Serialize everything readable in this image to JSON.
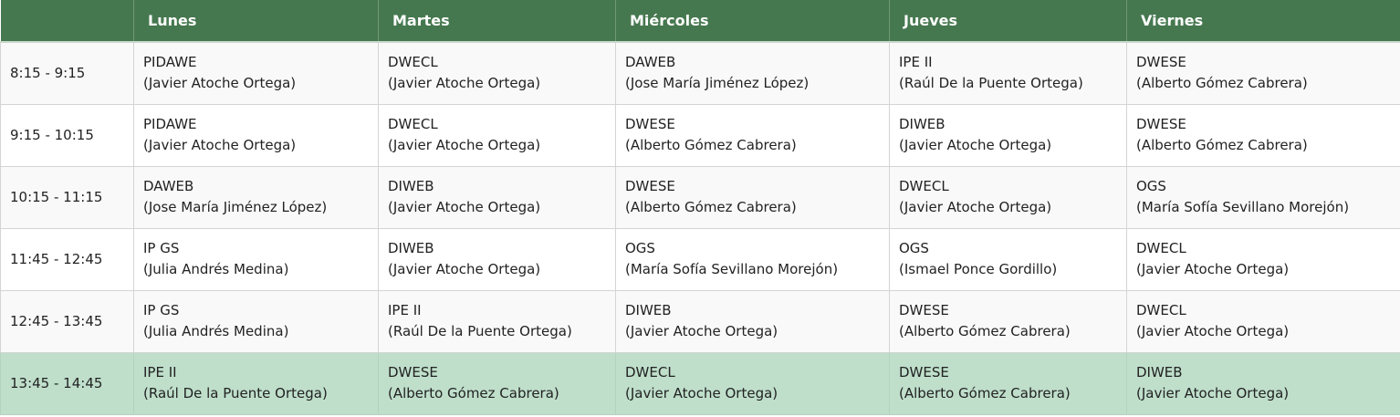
{
  "header": {
    "time_label": "",
    "days": [
      "Lunes",
      "Martes",
      "Miércoles",
      "Jueves",
      "Viernes"
    ]
  },
  "colors": {
    "header_bg": "#46784f",
    "header_text": "#ffffff",
    "highlight_row": "#bfdfcb",
    "odd_row": "#f9f9f9",
    "even_row": "#ffffff"
  },
  "rows": [
    {
      "time": "8:15 - 9:15",
      "cells": [
        {
          "subject": "PIDAWE",
          "teacher": "(Javier Atoche Ortega)"
        },
        {
          "subject": "DWECL",
          "teacher": "(Javier Atoche Ortega)"
        },
        {
          "subject": "DAWEB",
          "teacher": "(Jose María Jiménez López)"
        },
        {
          "subject": "IPE II",
          "teacher": "(Raúl De la Puente Ortega)"
        },
        {
          "subject": "DWESE",
          "teacher": "(Alberto Gómez Cabrera)"
        }
      ]
    },
    {
      "time": "9:15 - 10:15",
      "cells": [
        {
          "subject": "PIDAWE",
          "teacher": "(Javier Atoche Ortega)"
        },
        {
          "subject": "DWECL",
          "teacher": "(Javier Atoche Ortega)"
        },
        {
          "subject": "DWESE",
          "teacher": "(Alberto Gómez Cabrera)"
        },
        {
          "subject": "DIWEB",
          "teacher": "(Javier Atoche Ortega)"
        },
        {
          "subject": "DWESE",
          "teacher": "(Alberto Gómez Cabrera)"
        }
      ]
    },
    {
      "time": "10:15 - 11:15",
      "cells": [
        {
          "subject": "DAWEB",
          "teacher": "(Jose María Jiménez López)"
        },
        {
          "subject": "DIWEB",
          "teacher": "(Javier Atoche Ortega)"
        },
        {
          "subject": "DWESE",
          "teacher": "(Alberto Gómez Cabrera)"
        },
        {
          "subject": "DWECL",
          "teacher": "(Javier Atoche Ortega)"
        },
        {
          "subject": "OGS",
          "teacher": "(María Sofía Sevillano Morejón)"
        }
      ]
    },
    {
      "time": "11:45 - 12:45",
      "cells": [
        {
          "subject": "IP GS",
          "teacher": "(Julia Andrés Medina)"
        },
        {
          "subject": "DIWEB",
          "teacher": "(Javier Atoche Ortega)"
        },
        {
          "subject": "OGS",
          "teacher": "(María Sofía Sevillano Morejón)"
        },
        {
          "subject": "OGS",
          "teacher": "(Ismael Ponce Gordillo)"
        },
        {
          "subject": "DWECL",
          "teacher": "(Javier Atoche Ortega)"
        }
      ]
    },
    {
      "time": "12:45 - 13:45",
      "cells": [
        {
          "subject": "IP GS",
          "teacher": "(Julia Andrés Medina)"
        },
        {
          "subject": "IPE II",
          "teacher": "(Raúl De la Puente Ortega)"
        },
        {
          "subject": "DIWEB",
          "teacher": "(Javier Atoche Ortega)"
        },
        {
          "subject": "DWESE",
          "teacher": "(Alberto Gómez Cabrera)"
        },
        {
          "subject": "DWECL",
          "teacher": "(Javier Atoche Ortega)"
        }
      ]
    },
    {
      "time": "13:45 - 14:45",
      "cells": [
        {
          "subject": "IPE II",
          "teacher": "(Raúl De la Puente Ortega)"
        },
        {
          "subject": "DWESE",
          "teacher": "(Alberto Gómez Cabrera)"
        },
        {
          "subject": "DWECL",
          "teacher": "(Javier Atoche Ortega)"
        },
        {
          "subject": "DWESE",
          "teacher": "(Alberto Gómez Cabrera)"
        },
        {
          "subject": "DIWEB",
          "teacher": "(Javier Atoche Ortega)"
        }
      ]
    }
  ]
}
